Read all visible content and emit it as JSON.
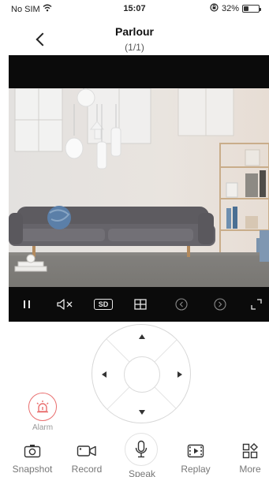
{
  "status_bar": {
    "carrier": "No SIM",
    "time": "15:07",
    "battery": "32%",
    "battery_level": 0.32
  },
  "header": {
    "title": "Parlour",
    "subtitle": "(1/1)"
  },
  "video_controls": {
    "quality_label": "SD"
  },
  "alarm": {
    "label": "Alarm"
  },
  "toolbar": {
    "snapshot": "Snapshot",
    "record": "Record",
    "speak": "Speak",
    "replay": "Replay",
    "more": "More"
  },
  "colors": {
    "alarm": "#e96e6e",
    "video_bg": "#0b0b0b",
    "text_muted": "#777777"
  }
}
